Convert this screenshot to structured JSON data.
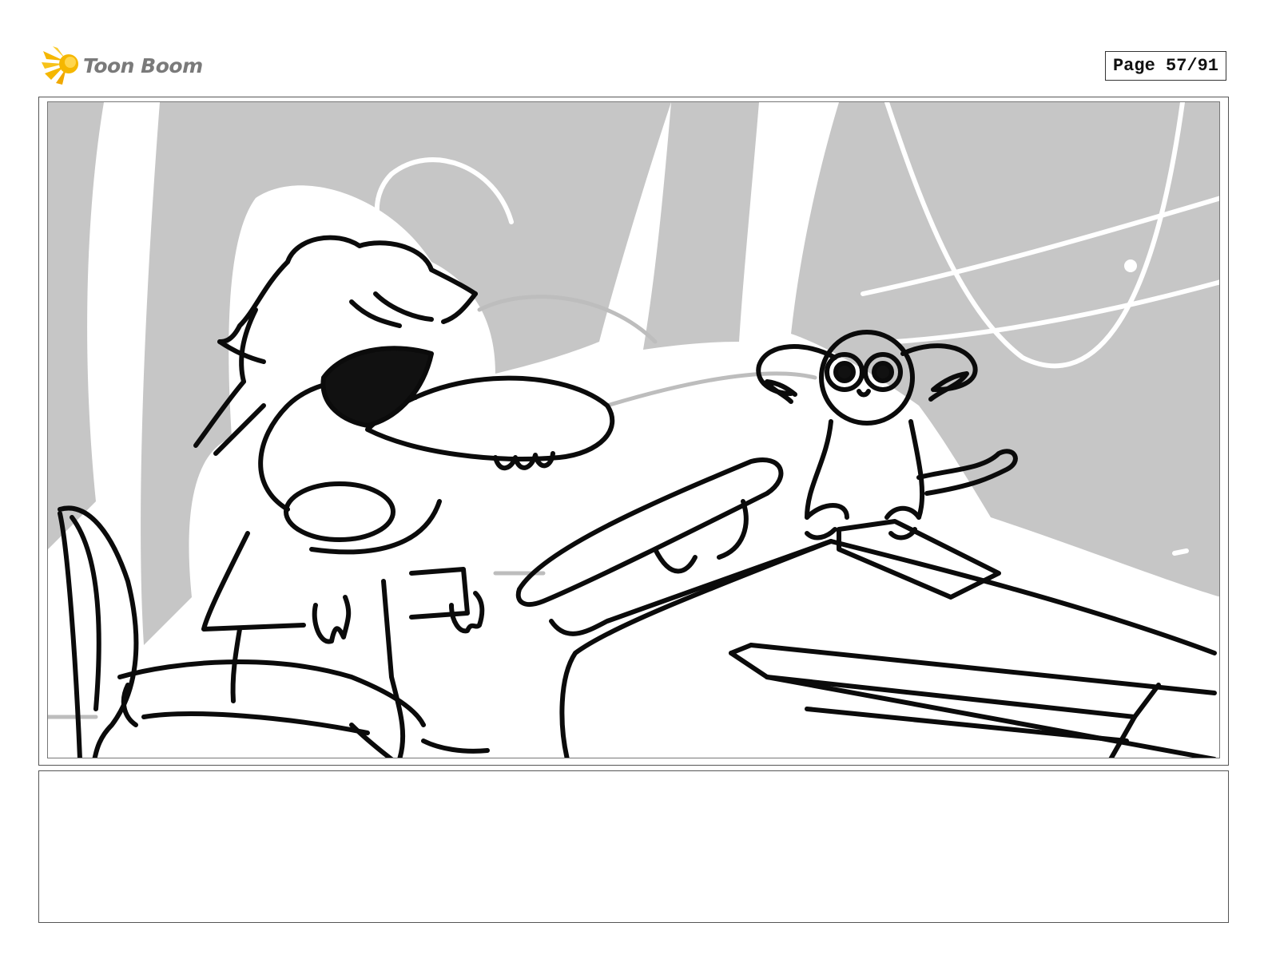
{
  "header": {
    "brand": "Toon Boom",
    "page_label": "Page 57/91"
  },
  "colors": {
    "brand_burst": "#f5b700",
    "sketch_gray": "#c4c4c4",
    "ink": "#0b0b0b"
  },
  "icons": {
    "logo": "toon-boom-burst-icon"
  },
  "panel": {
    "drawing": "storyboard-sketch"
  },
  "notes": {
    "text": ""
  }
}
